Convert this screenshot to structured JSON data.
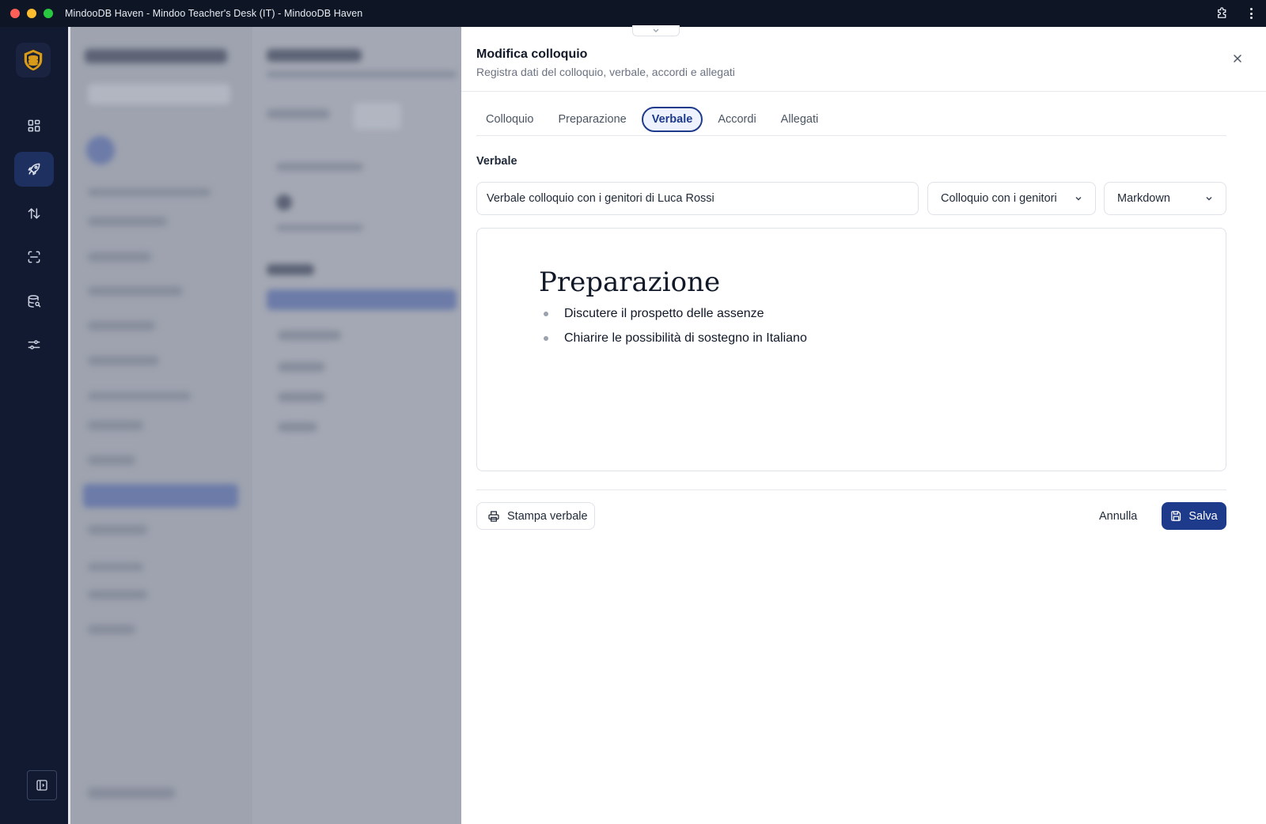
{
  "window": {
    "title": "MindooDB Haven - Mindoo Teacher's Desk (IT) - MindooDB Haven"
  },
  "colors": {
    "accent": "#1e3a8a",
    "rail_bg": "#111a30",
    "rail_active": "#1e3060"
  },
  "rail": {
    "logo_icon": "shield-logo-icon",
    "items": [
      {
        "icon": "grid-icon",
        "active": false
      },
      {
        "icon": "rocket-icon",
        "active": true
      },
      {
        "icon": "sort-arrows-icon",
        "active": false
      },
      {
        "icon": "scan-icon",
        "active": false
      },
      {
        "icon": "database-search-icon",
        "active": false
      },
      {
        "icon": "sliders-icon",
        "active": false
      }
    ],
    "bottom_icon": "sidebar-toggle-icon"
  },
  "drawer": {
    "title": "Modifica colloquio",
    "subtitle": "Registra dati del colloquio, verbale, accordi e allegati",
    "tabs": [
      {
        "label": "Colloquio",
        "active": false
      },
      {
        "label": "Preparazione",
        "active": false
      },
      {
        "label": "Verbale",
        "active": true
      },
      {
        "label": "Accordi",
        "active": false
      },
      {
        "label": "Allegati",
        "active": false
      }
    ],
    "section_label": "Verbale",
    "title_field": {
      "value": "Verbale colloquio con i genitori di Luca Rossi"
    },
    "type_select": {
      "selected": "Colloquio con i genitori"
    },
    "format_select": {
      "selected": "Markdown"
    },
    "editor": {
      "heading": "Preparazione",
      "bullets": [
        "Discutere il prospetto delle assenze",
        "Chiarire le possibilità di sostegno in Italiano"
      ]
    },
    "footer": {
      "print_label": "Stampa verbale",
      "cancel_label": "Annulla",
      "save_label": "Salva"
    }
  }
}
